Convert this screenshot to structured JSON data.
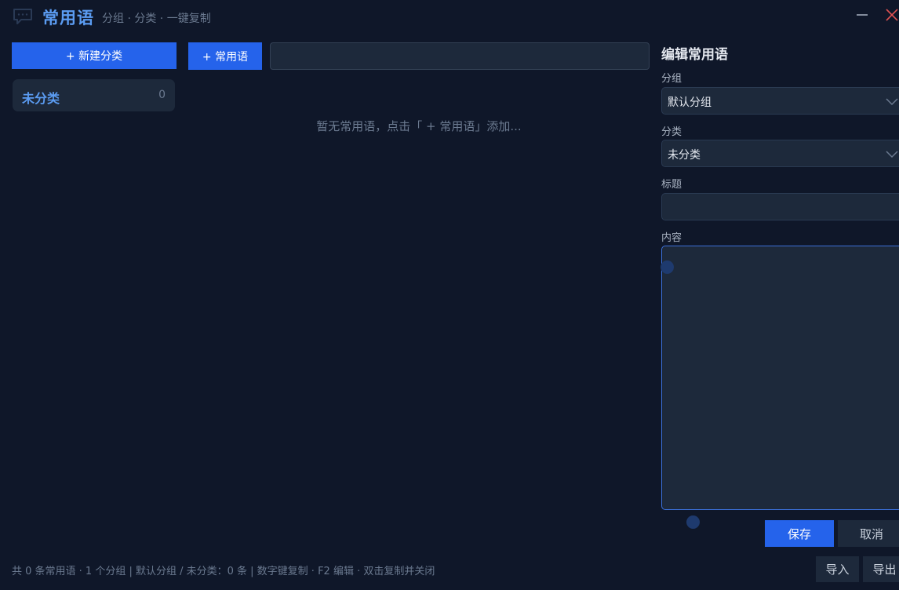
{
  "app": {
    "title": "常用语",
    "subtitle": "分组 · 分类 · 一键复制"
  },
  "sidebar": {
    "new_category_label": "+ 新建分类",
    "categories": [
      {
        "name": "未分类",
        "count": "0"
      }
    ]
  },
  "main": {
    "add_phrase_label": "+ 常用语",
    "search_value": "",
    "empty_hint": "暂无常用语，点击「 + 常用语」添加..."
  },
  "editor": {
    "title": "编辑常用语",
    "group_label": "分组",
    "group_value": "默认分组",
    "category_label": "分类",
    "category_value": "未分类",
    "title_label": "标题",
    "title_value": "",
    "content_label": "内容",
    "content_value": "",
    "save_label": "保存",
    "cancel_label": "取消"
  },
  "footer": {
    "status": "共 0 条常用语 · 1 个分组 | 默认分组 / 未分类：0 条 | 数字键复制 · F2 编辑 · 双击复制并关闭",
    "import_label": "导入",
    "export_label": "导出"
  },
  "colors": {
    "background": "#0f1729",
    "panel": "#1d293b",
    "accent": "#2563eb",
    "title_accent": "#5b9cf2",
    "close_red": "#e05252"
  },
  "icons": {
    "app": "chat-bubble-icon",
    "minimize": "minimize-icon",
    "close": "close-icon",
    "dropdown": "chevron-down-icon"
  }
}
